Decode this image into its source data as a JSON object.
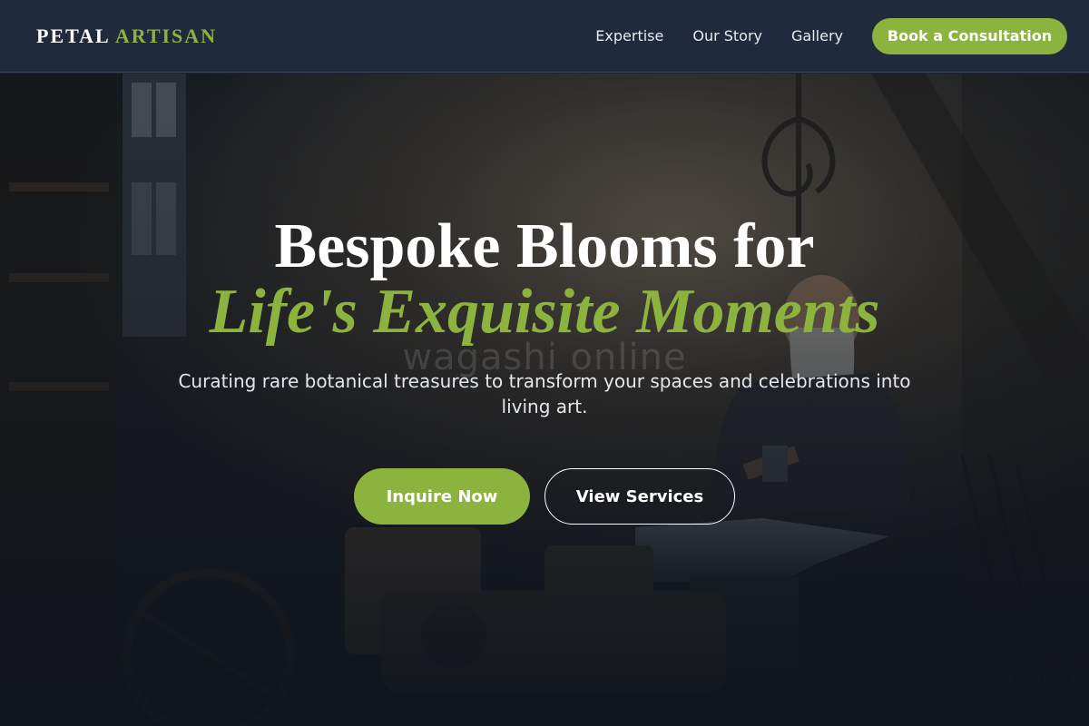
{
  "header": {
    "logo_word1": "PETAL",
    "logo_word2": "ARTISAN",
    "nav": [
      "Expertise",
      "Our Story",
      "Gallery"
    ],
    "cta_label": "Book a Consultation"
  },
  "hero": {
    "line1": "Bespoke Blooms for",
    "line2": "Life's Exquisite Moments",
    "subtitle": "Curating rare botanical treasures to transform your spaces and celebrations into living art.",
    "watermark": "wagashi online",
    "primary_button": "Inquire Now",
    "secondary_button": "View Services",
    "background_image": "blacksmith-workshop-photo"
  },
  "colors": {
    "accent": "#8db33f",
    "header_bg": "#1f2a3c",
    "text_light": "#ffffff"
  }
}
